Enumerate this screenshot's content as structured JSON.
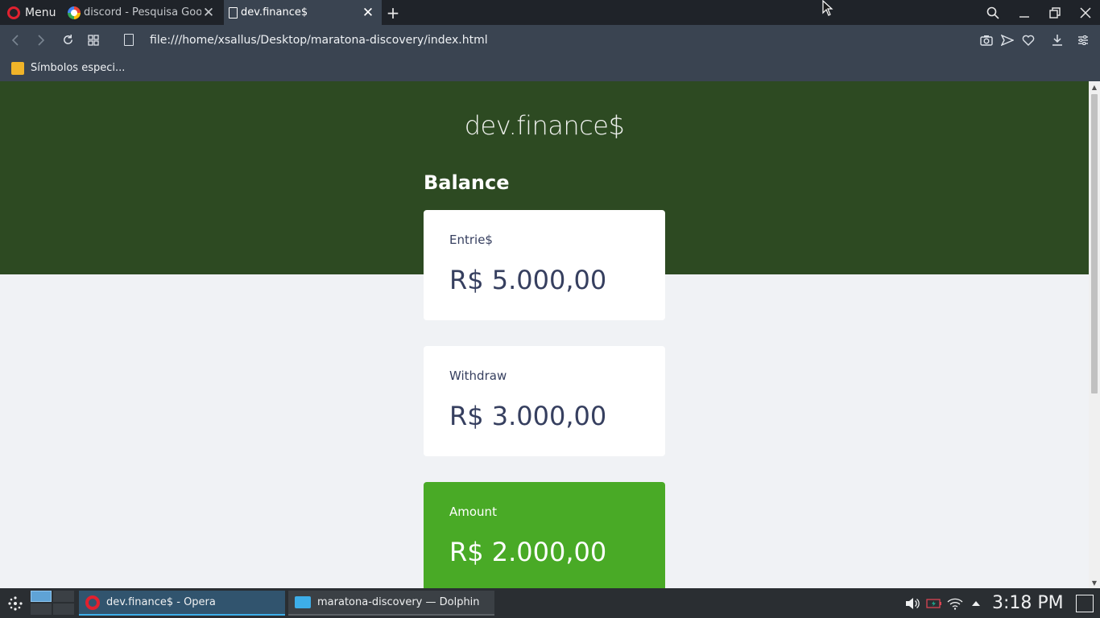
{
  "browser": {
    "menu_label": "Menu",
    "tabs": [
      {
        "title": "discord - Pesquisa Goog",
        "close": "✕"
      },
      {
        "title": "dev.finance$",
        "close": "✕"
      }
    ],
    "new_tab": "+",
    "url": "file:///home/xsallus/Desktop/maratona-discovery/index.html",
    "bookmark": "Símbolos especi..."
  },
  "page": {
    "logo": "dev.finance$",
    "balance_title": "Balance",
    "cards": [
      {
        "label": "Entrie$",
        "value": "R$ 5.000,00"
      },
      {
        "label": "Withdraw",
        "value": "R$ 3.000,00"
      },
      {
        "label": "Amount",
        "value": "R$ 2.000,00"
      }
    ],
    "colors": {
      "header": "#2d4a22",
      "total_card": "#49aa26",
      "card_text": "#363f5f",
      "page_bg": "#f0f2f5"
    }
  },
  "taskbar": {
    "tasks": [
      {
        "label": "dev.finance$ - Opera"
      },
      {
        "label": "maratona-discovery — Dolphin"
      }
    ],
    "clock": "3:18 PM"
  }
}
